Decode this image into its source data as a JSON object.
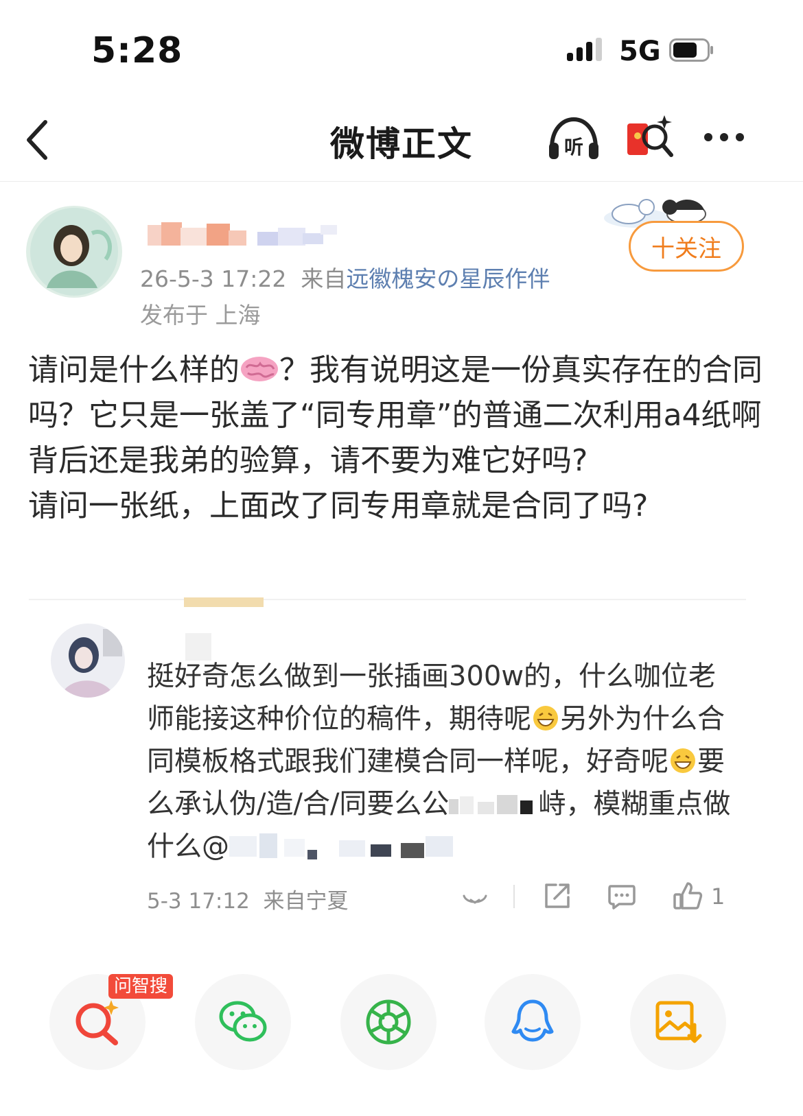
{
  "status_bar": {
    "time": "5:28",
    "network": "5G"
  },
  "nav": {
    "title": "微博正文"
  },
  "post": {
    "timestamp": "26-5-3 17:22",
    "source_prefix": "来自",
    "source": "远徽槐安の星辰作伴",
    "location": "发布于 上海",
    "follow_label": "十关注",
    "body_line1_a": "请问是什么样的",
    "body_line1_b": "？我有说明这是一份真实存在的合同吗？它只是一张盖了“同专用章”的普通二次利用a4纸啊背后还是我弟的验算，请不要为难它好吗?",
    "body_line2": "请问一张纸，上面改了同专用章就是合同了吗?"
  },
  "comment": {
    "text_a": "挺好奇怎么做到一张插画300w的，什么咖位老师能接这种价位的稿件，期待呢",
    "text_b": "另外为什么合同模板格式跟我们建模合同一样呢，好奇呢",
    "text_c": "要么承认伪/造/合/同要么公",
    "text_d": "峙，模糊重点做什么@",
    "timestamp": "5-3 17:12",
    "source": "来自宁夏",
    "like_count": "1"
  },
  "share_bar": {
    "badge": "问智搜"
  },
  "colors": {
    "accent_orange": "#f07d1d",
    "link_blue": "#5d7fb0",
    "badge_red": "#f24b3a"
  },
  "icons": [
    "back-icon",
    "listen-icon",
    "red-envelope-icon",
    "more-icon",
    "brain-emoji",
    "grin-emoji",
    "share-icon",
    "comment-icon",
    "like-icon",
    "smart-search-icon",
    "wechat-icon",
    "moments-icon",
    "qq-icon",
    "save-image-icon"
  ]
}
